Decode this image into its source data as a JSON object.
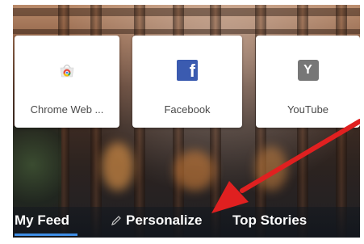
{
  "top_sites": [
    {
      "label": "Chrome Web ...",
      "icon": "chrome-web-store-icon"
    },
    {
      "label": "Facebook",
      "icon": "facebook-icon",
      "glyph": "f"
    },
    {
      "label": "YouTube",
      "icon": "youtube-icon",
      "glyph": "Y"
    }
  ],
  "nav": {
    "my_feed": "My Feed",
    "personalize": "Personalize",
    "top_stories": "Top Stories"
  },
  "colors": {
    "accent_underline": "#3f8ee6",
    "facebook_blue": "#3b5bb0",
    "annotation_arrow": "#e02020"
  }
}
